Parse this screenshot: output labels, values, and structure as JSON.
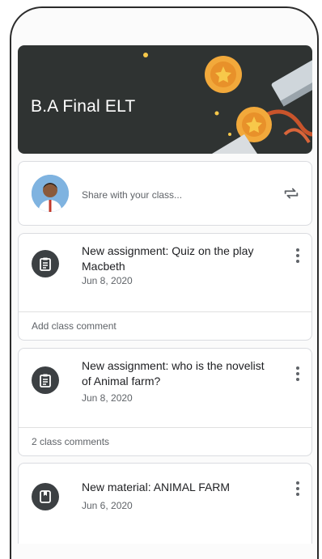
{
  "course": {
    "title": "B.A Final ELT"
  },
  "share": {
    "placeholder": "Share with your class..."
  },
  "posts": [
    {
      "title": "New assignment: Quiz on the play Macbeth",
      "date": "Jun 8, 2020",
      "comment": "Add class comment",
      "icon": "assignment-icon"
    },
    {
      "title": "New assignment: who is the novelist of Animal farm?",
      "date": "Jun 8, 2020",
      "comment": "2 class comments",
      "icon": "assignment-icon"
    },
    {
      "title": "New material: ANIMAL FARM",
      "date": "Jun 6, 2020",
      "icon": "material-icon"
    }
  ],
  "colors": {
    "banner": "#2f3332",
    "icon_bg": "#3c4043",
    "coin": "#f2a93b"
  }
}
